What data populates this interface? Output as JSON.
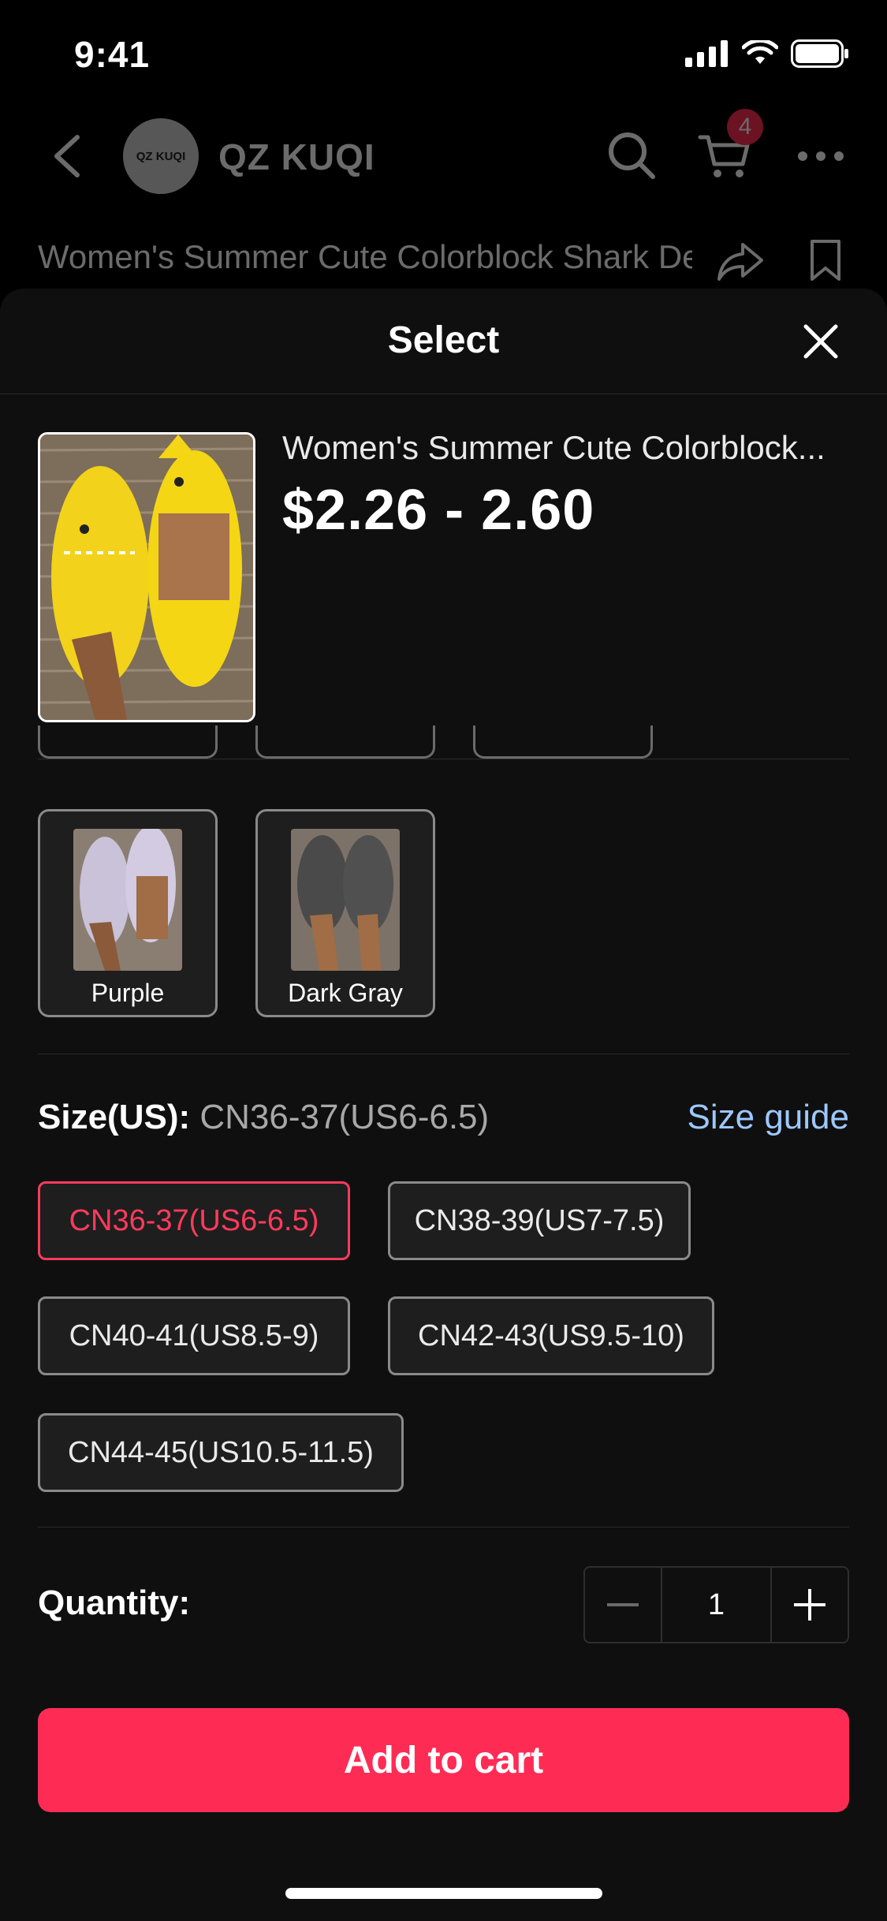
{
  "status_bar": {
    "time": "9:41"
  },
  "shop": {
    "avatar_text": "QZ KUQI",
    "name": "QZ KUQI",
    "cart_count": "4"
  },
  "background": {
    "title": "Women's Summer Cute Colorblock Shark Design Slippers, Shower S..."
  },
  "sheet": {
    "title": "Select",
    "product": {
      "name": "Women's Summer Cute Colorblock...",
      "price": "$2.26 - 2.60"
    },
    "variants": [
      {
        "label": "Purple"
      },
      {
        "label": "Dark Gray"
      }
    ],
    "size": {
      "label": "Size(US):",
      "selected": "CN36-37(US6-6.5)",
      "guide": "Size guide",
      "options": [
        "CN36-37(US6-6.5)",
        "CN38-39(US7-7.5)",
        "CN40-41(US8.5-9)",
        "CN42-43(US9.5-10)",
        "CN44-45(US10.5-11.5)"
      ]
    },
    "quantity": {
      "label": "Quantity:",
      "value": "1"
    },
    "add_to_cart": "Add to cart"
  },
  "colors": {
    "accent": "#fe2c55",
    "link": "#9cc8ff",
    "sheet_bg": "#0f0f0f"
  }
}
